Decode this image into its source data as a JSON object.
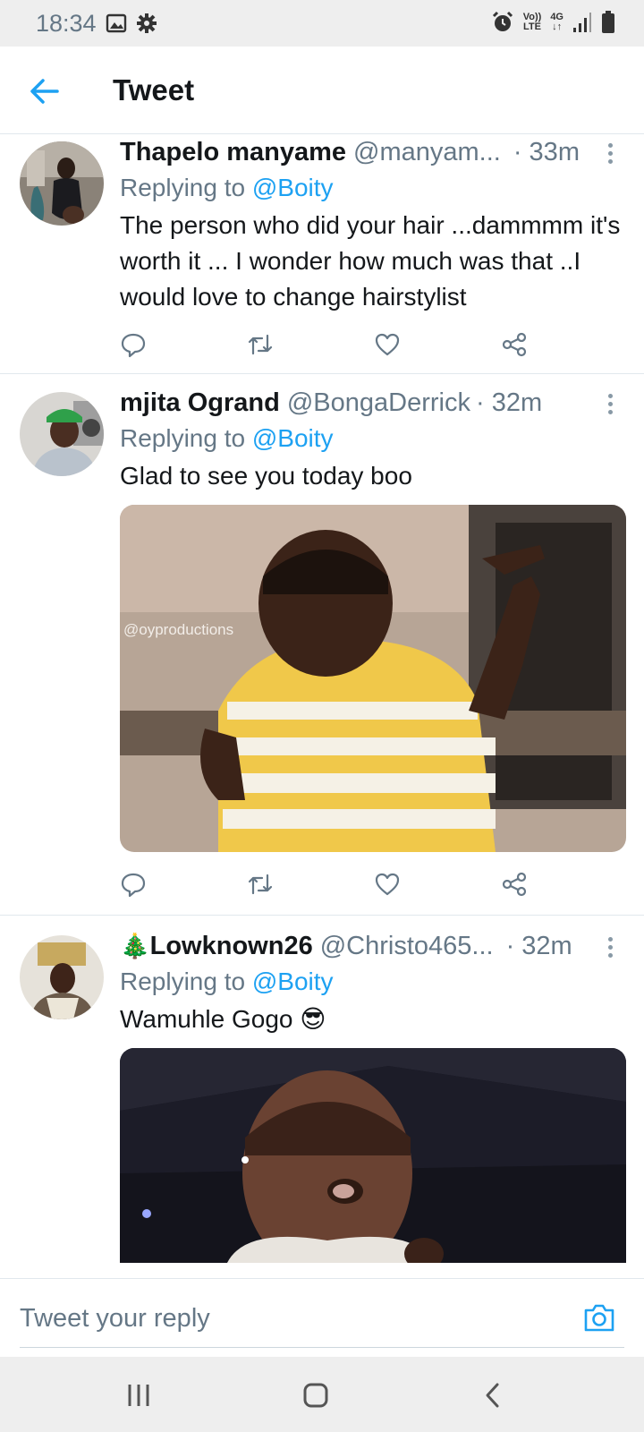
{
  "status_bar": {
    "time": "18:34",
    "left_icons": [
      "image-icon",
      "gear-icon"
    ],
    "right_icons": [
      "alarm-icon",
      "volte-icon",
      "4g-icon",
      "signal-icon",
      "battery-icon"
    ],
    "volte_line1": "Vo))",
    "volte_line2": "LTE",
    "net_line1": "4G",
    "net_line2": "↓↑"
  },
  "app_bar": {
    "back_icon": "arrow-left-icon",
    "title": "Tweet"
  },
  "colors": {
    "accent": "#1da1f2",
    "text": "#14171a",
    "secondary": "#657786",
    "divider": "#e1e8ed"
  },
  "tweets": [
    {
      "name": "Thapelo manyame",
      "handle": "@manyam...",
      "time": "· 33m",
      "replying_prefix": "Replying to",
      "replying_to": "@Boity",
      "text": "The person who did your hair ...dammmm it's worth it ... I wonder how much was that ..I would love to change hairstylist",
      "actions": [
        "reply-icon",
        "retweet-icon",
        "like-icon",
        "share-icon"
      ]
    },
    {
      "name": "mjita Ogrand",
      "handle": "@BongaDerrick",
      "time": "· 32m",
      "replying_prefix": "Replying to",
      "replying_to": "@Boity",
      "text": "Glad to see you today boo",
      "media_watermark": "@oyproductions",
      "actions": [
        "reply-icon",
        "retweet-icon",
        "like-icon",
        "share-icon"
      ]
    },
    {
      "name_emoji": "🎄",
      "name": "Lowknown26",
      "handle": "@Christo465...",
      "time": "· 32m",
      "replying_prefix": "Replying to",
      "replying_to": "@Boity",
      "text": "Wamuhle Gogo",
      "text_emoji": "😎"
    }
  ],
  "reply_bar": {
    "placeholder": "Tweet your reply",
    "camera_icon": "camera-icon"
  },
  "nav_bar": {
    "buttons": [
      "recents-icon",
      "home-icon",
      "back-icon"
    ]
  }
}
